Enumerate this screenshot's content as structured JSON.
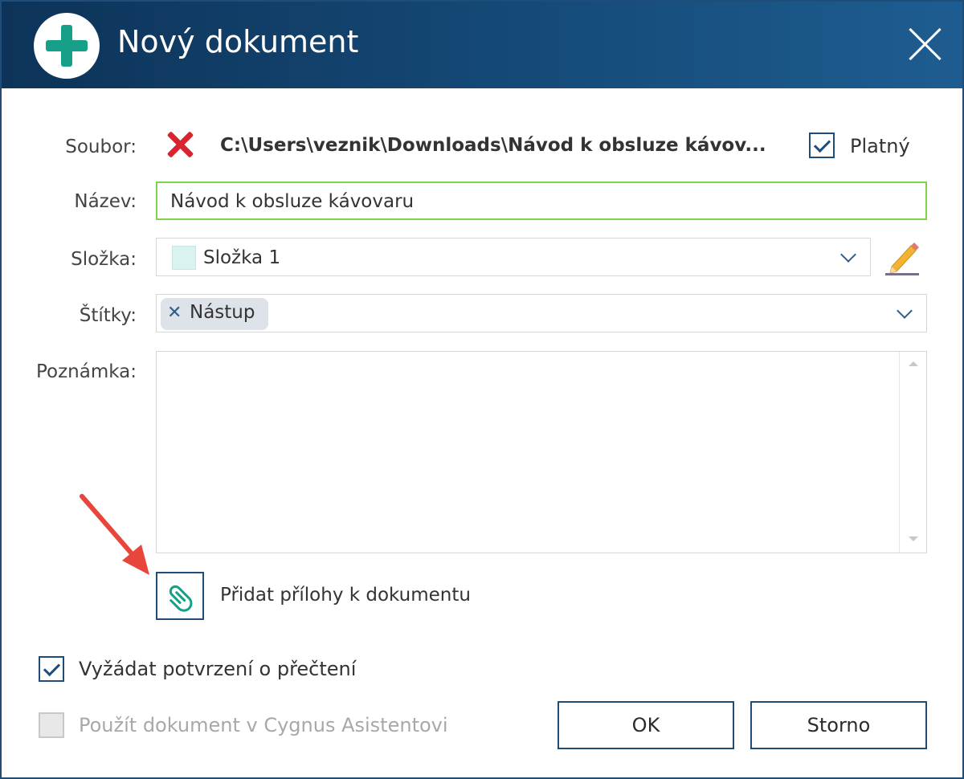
{
  "dialog": {
    "title": "Nový dokument",
    "accent_color": "#16a089",
    "titlebar_color": "#154a78"
  },
  "fields": {
    "file_label": "Soubor:",
    "file_status_icon": "error-x-icon",
    "file_path": "C:\\Users\\veznik\\Downloads\\Návod k obsluze kávov...",
    "valid_label": "Platný",
    "valid_checked": true,
    "name_label": "Název:",
    "name_value": "Návod k obsluze kávovaru",
    "folder_label": "Složka:",
    "folder_value": "Složka 1",
    "folder_color": "#d9f3f1",
    "tags_label": "Štítky:",
    "tags": [
      "Nástup"
    ],
    "note_label": "Poznámka:",
    "note_value": ""
  },
  "attachments": {
    "label": "Přidat přílohy k dokumentu"
  },
  "options": {
    "read_confirm_label": "Vyžádat potvrzení o přečtení",
    "read_confirm_checked": true,
    "assistant_label": "Použít dokument v Cygnus Asistentovi",
    "assistant_checked": false,
    "assistant_disabled": true
  },
  "buttons": {
    "ok": "OK",
    "cancel": "Storno"
  }
}
